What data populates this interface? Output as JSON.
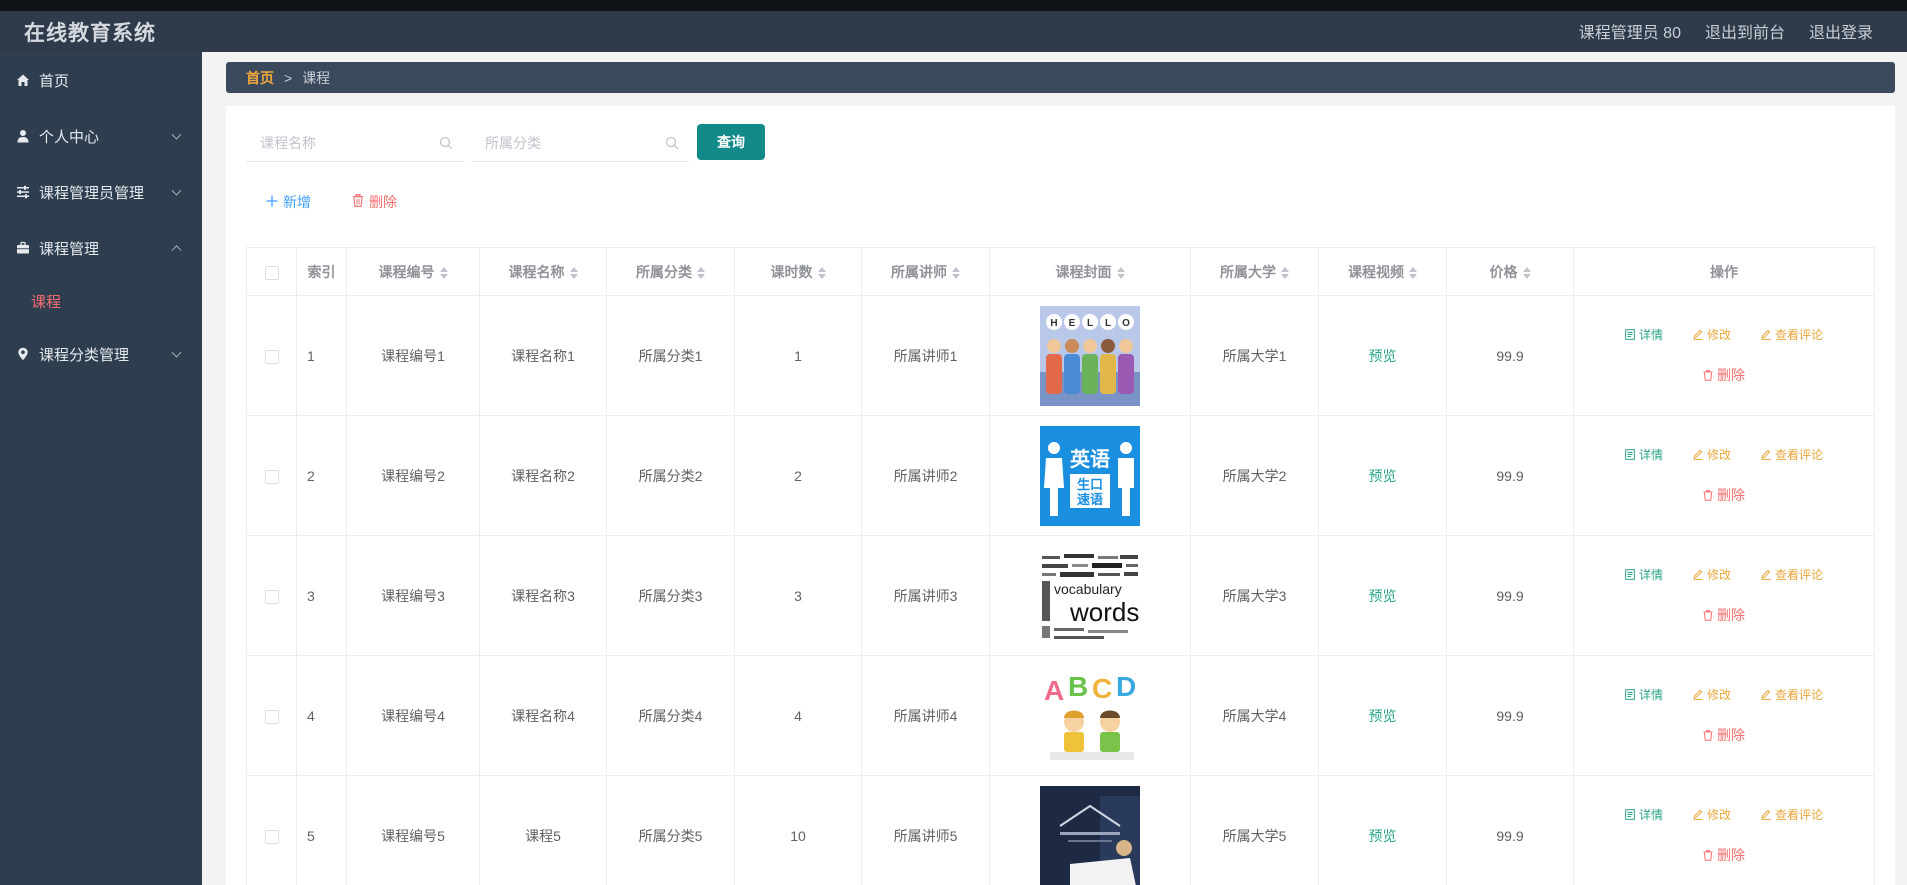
{
  "app": {
    "title": "在线教育系统"
  },
  "topbar": {
    "user": "课程管理员 80",
    "front": "退出到前台",
    "logout": "退出登录"
  },
  "sidebar": {
    "items": [
      {
        "label": "首页",
        "icon": "home-icon"
      },
      {
        "label": "个人中心",
        "icon": "user-icon"
      },
      {
        "label": "课程管理员管理",
        "icon": "sliders-icon"
      },
      {
        "label": "课程管理",
        "icon": "briefcase-icon"
      },
      {
        "label": "课程分类管理",
        "icon": "location-icon"
      }
    ],
    "submenu": {
      "label": "课程"
    }
  },
  "breadcrumb": {
    "home": "首页",
    "separator": ">",
    "current": "课程"
  },
  "search": {
    "name_placeholder": "课程名称",
    "category_placeholder": "所属分类",
    "query_label": "查询"
  },
  "actions": {
    "add_label": "新增",
    "delete_label": "删除"
  },
  "table": {
    "headers": [
      "索引",
      "课程编号",
      "课程名称",
      "所属分类",
      "课时数",
      "所属讲师",
      "课程封面",
      "所属大学",
      "课程视频",
      "价格",
      "操作"
    ],
    "rows": [
      {
        "index": "1",
        "code": "课程编号1",
        "name": "课程名称1",
        "category": "所属分类1",
        "hours": "1",
        "teacher": "所属讲师1",
        "cover": "HELLO",
        "university": "所属大学1",
        "video": "预览",
        "price": "99.9"
      },
      {
        "index": "2",
        "code": "课程编号2",
        "name": "课程名称2",
        "category": "所属分类2",
        "hours": "2",
        "teacher": "所属讲师2",
        "cover": "英语口语",
        "university": "所属大学2",
        "video": "预览",
        "price": "99.9"
      },
      {
        "index": "3",
        "code": "课程编号3",
        "name": "课程名称3",
        "category": "所属分类3",
        "hours": "3",
        "teacher": "所属讲师3",
        "cover": "words",
        "university": "所属大学3",
        "video": "预览",
        "price": "99.9"
      },
      {
        "index": "4",
        "code": "课程编号4",
        "name": "课程名称4",
        "category": "所属分类4",
        "hours": "4",
        "teacher": "所属讲师4",
        "cover": "ABCD",
        "university": "所属大学4",
        "video": "预览",
        "price": "99.9"
      },
      {
        "index": "5",
        "code": "课程编号5",
        "name": "课程5",
        "category": "所属分类5",
        "hours": "10",
        "teacher": "所属讲师5",
        "cover": "",
        "university": "所属大学5",
        "video": "预览",
        "price": "99.9"
      }
    ],
    "ops": {
      "detail": "详情",
      "edit": "修改",
      "comment": "查看评论",
      "delete": "删除"
    }
  },
  "colors": {
    "accent": "#138a8a",
    "danger": "#f56c6c",
    "link": "#409eff",
    "sidebar": "#2e3e4f",
    "topbar": "#2f3b4a"
  }
}
